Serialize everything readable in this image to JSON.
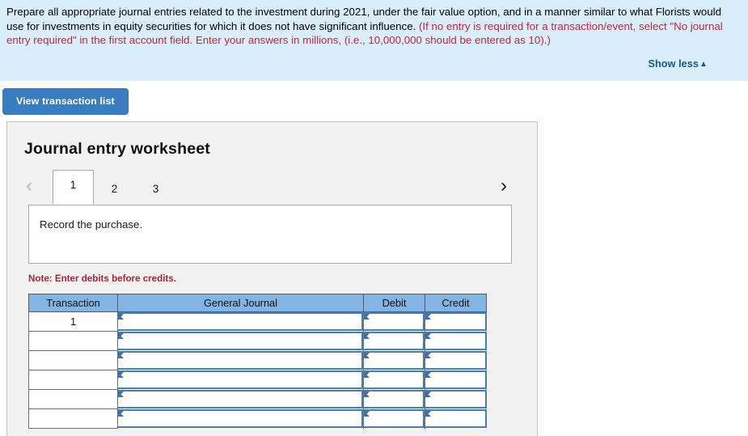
{
  "banner": {
    "paragraph_black_1": "Prepare all appropriate journal entries related to the investment during 2021, under the fair value option, and in a manner similar to what Florists would use for investments in equity securities for which it does not have significant influence. ",
    "paragraph_red_1": "(If no entry is required for a transaction/event, select \"No journal entry required\" in the first account field. Enter your answers in millions, (i.e., 10,000,000 should be entered as 10).)",
    "show_less_label": "Show less",
    "show_less_caret": "▲",
    "background_color": "#daedfa",
    "red_color": "#b8293d",
    "link_color": "#17559c"
  },
  "toolbar": {
    "view_transaction_list_label": "View transaction list",
    "button_color": "#3a7cc0"
  },
  "worksheet": {
    "title": "Journal entry worksheet",
    "prev_arrow": "‹",
    "next_arrow": "›",
    "tabs": [
      {
        "label": "1",
        "active": true
      },
      {
        "label": "2",
        "active": false
      },
      {
        "label": "3",
        "active": false
      }
    ],
    "description": "Record the purchase.",
    "note": "Note: Enter debits before credits.",
    "note_color": "#a7283a"
  },
  "journal_table": {
    "header_color": "#83b4e3",
    "columns": [
      "Transaction",
      "General Journal",
      "Debit",
      "Credit"
    ],
    "rows": [
      {
        "transaction": "1",
        "general_journal": "",
        "debit": "",
        "credit": ""
      },
      {
        "transaction": "",
        "general_journal": "",
        "debit": "",
        "credit": ""
      },
      {
        "transaction": "",
        "general_journal": "",
        "debit": "",
        "credit": ""
      },
      {
        "transaction": "",
        "general_journal": "",
        "debit": "",
        "credit": ""
      },
      {
        "transaction": "",
        "general_journal": "",
        "debit": "",
        "credit": ""
      },
      {
        "transaction": "",
        "general_journal": "",
        "debit": "",
        "credit": ""
      }
    ]
  }
}
